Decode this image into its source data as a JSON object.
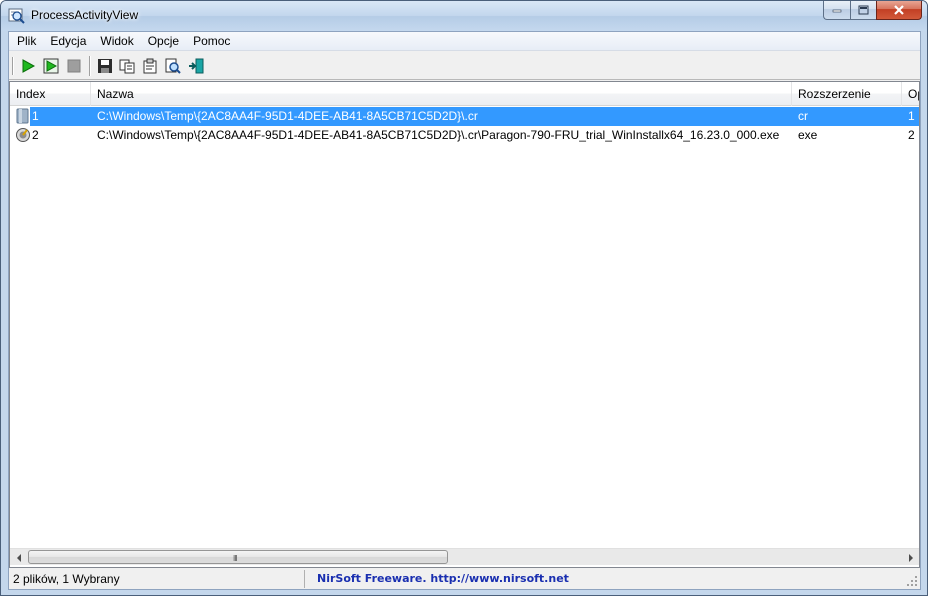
{
  "window": {
    "title": "ProcessActivityView"
  },
  "menu": {
    "items": [
      {
        "label": "Plik"
      },
      {
        "label": "Edycja"
      },
      {
        "label": "Widok"
      },
      {
        "label": "Opcje"
      },
      {
        "label": "Pomoc"
      }
    ]
  },
  "toolbar": {
    "buttons": [
      {
        "icon": "play-icon"
      },
      {
        "icon": "play-refresh-icon"
      },
      {
        "icon": "stop-icon"
      },
      {
        "icon": "save-icon"
      },
      {
        "icon": "copy-icon"
      },
      {
        "icon": "properties-icon"
      },
      {
        "icon": "find-icon"
      },
      {
        "icon": "exit-icon"
      }
    ]
  },
  "table": {
    "columns": [
      {
        "label": "Index"
      },
      {
        "label": "Nazwa"
      },
      {
        "label": "Rozszerzenie"
      },
      {
        "label": "Op"
      }
    ],
    "rows": [
      {
        "index": "1",
        "name": "C:\\Windows\\Temp\\{2AC8AA4F-95D1-4DEE-AB41-8A5CB71C5D2D}\\.cr",
        "ext": "cr",
        "op": "1",
        "icon": "folder-icon",
        "selected": true
      },
      {
        "index": "2",
        "name": "C:\\Windows\\Temp\\{2AC8AA4F-95D1-4DEE-AB41-8A5CB71C5D2D}\\.cr\\Paragon-790-FRU_trial_WinInstallx64_16.23.0_000.exe",
        "ext": "exe",
        "op": "2",
        "icon": "setup-exe-icon",
        "selected": false
      }
    ]
  },
  "scrollbar": {
    "grip": "III"
  },
  "status": {
    "summary": "2 plików, 1 Wybrany",
    "link": "NirSoft Freeware.  http://www.nirsoft.net"
  },
  "colors": {
    "selection": "#3399ff",
    "link": "#1a2fb0"
  }
}
